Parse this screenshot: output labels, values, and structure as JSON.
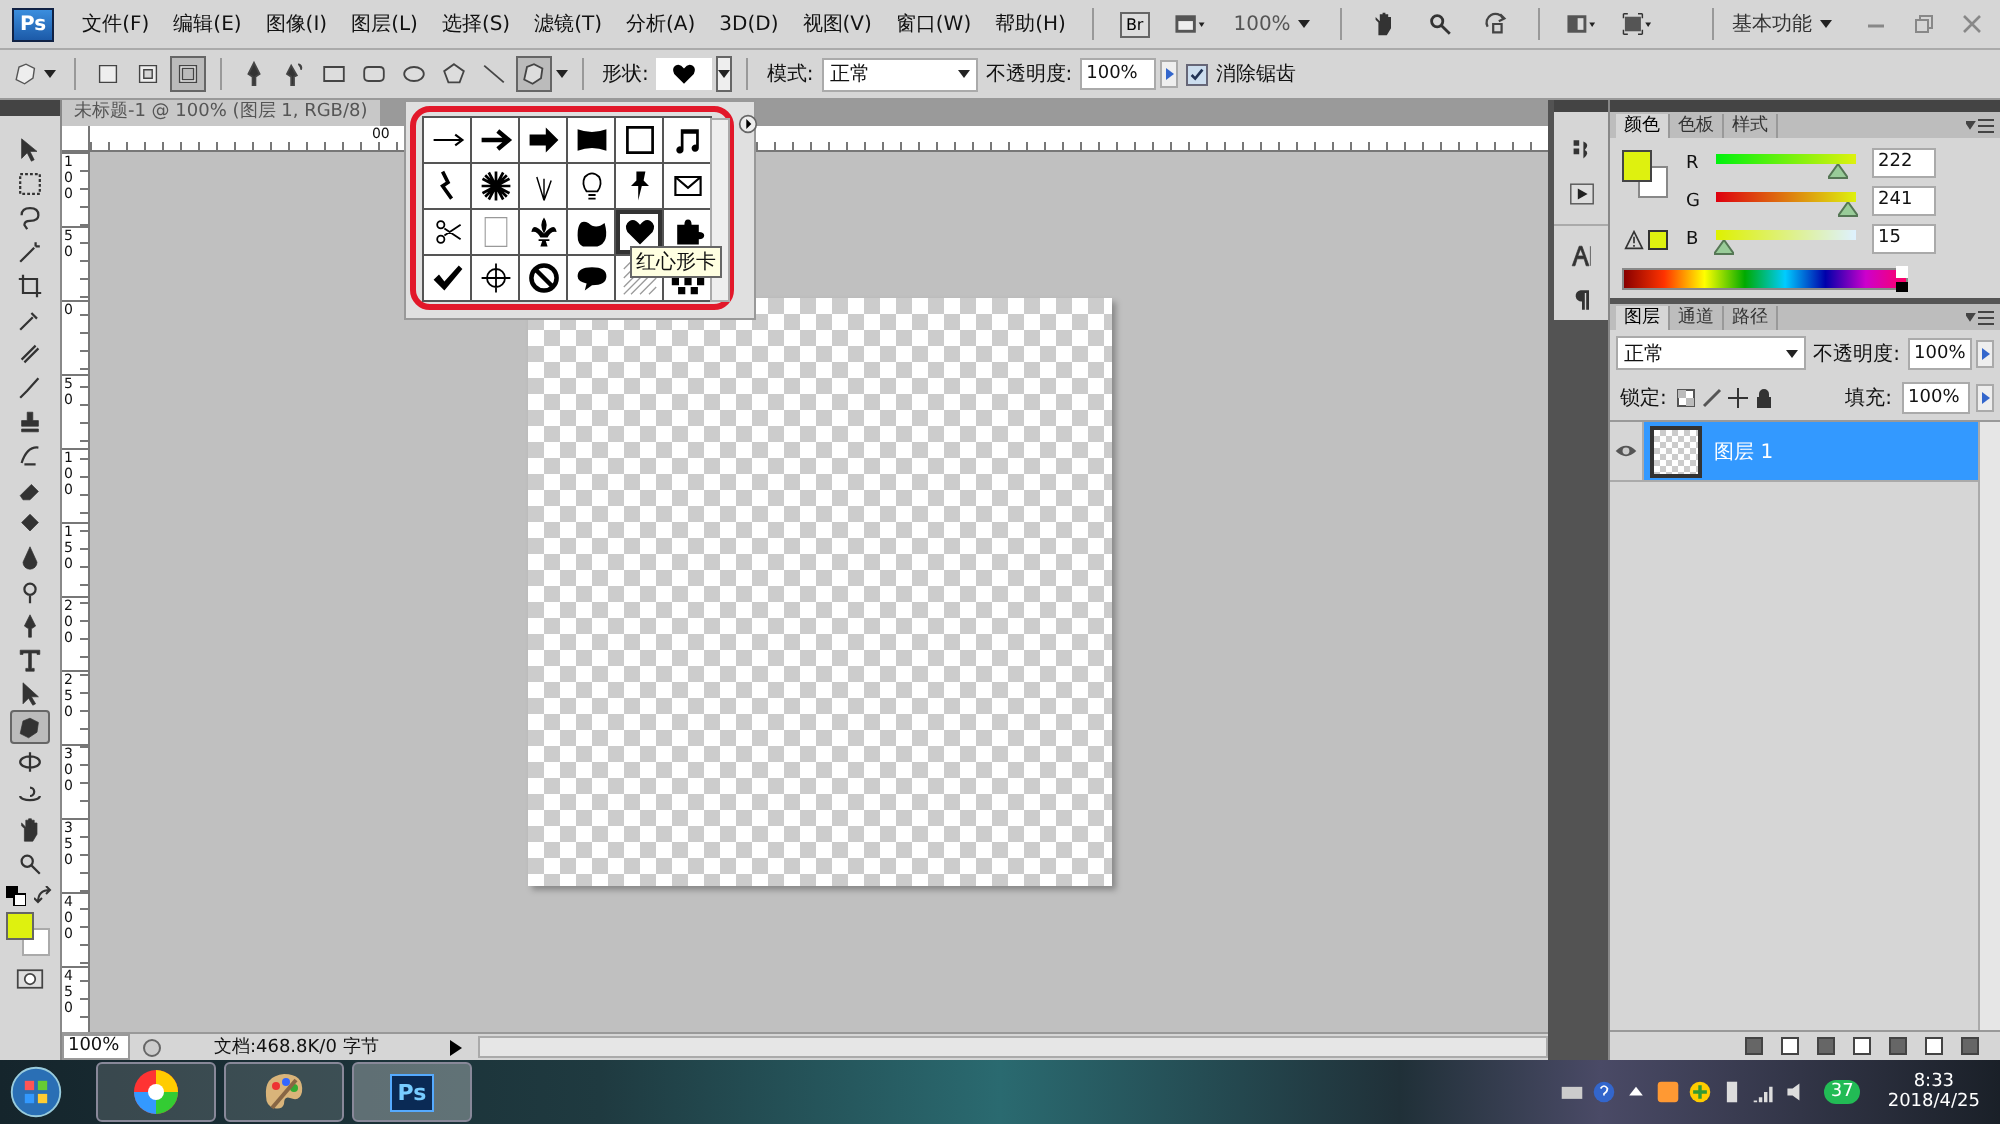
{
  "app_bar": {
    "logo": "Ps",
    "menus": [
      "文件(F)",
      "编辑(E)",
      "图像(I)",
      "图层(L)",
      "选择(S)",
      "滤镜(T)",
      "分析(A)",
      "3D(D)",
      "视图(V)",
      "窗口(W)",
      "帮助(H)"
    ],
    "bridge_button": "Br",
    "zoom": "100%",
    "workspace": "基本功能"
  },
  "options_bar": {
    "path_modes": [
      {
        "kind": "shape-layers",
        "selected": false
      },
      {
        "kind": "paths",
        "selected": false
      },
      {
        "kind": "fill-pixels",
        "selected": true
      }
    ],
    "draw_tools": [
      {
        "kind": "pen",
        "selected": false
      },
      {
        "kind": "freeform-pen",
        "selected": false
      },
      {
        "kind": "rectangle",
        "selected": false
      },
      {
        "kind": "rounded-rectangle",
        "selected": false
      },
      {
        "kind": "ellipse",
        "selected": false
      },
      {
        "kind": "polygon",
        "selected": false
      },
      {
        "kind": "line",
        "selected": false
      },
      {
        "kind": "custom-shape",
        "selected": true
      }
    ],
    "shape_label": "形状:",
    "mode_label": "模式:",
    "mode": "正常",
    "opacity_label": "不透明度:",
    "opacity": "100%",
    "antialias_label": "消除锯齿",
    "antialias": true
  },
  "document": {
    "tab": "未标题-1 @ 100% (图层 1, RGB/8)",
    "top_ruler_labels": [
      "00"
    ],
    "left_ruler_labels": [
      "100",
      "50",
      "0",
      "50",
      "100",
      "150",
      "200",
      "250",
      "300",
      "350",
      "400",
      "450"
    ],
    "zoom": "100%",
    "doc_info": "文档:468.8K/0 字节"
  },
  "toolbox": [
    {
      "kind": "move",
      "selected": false
    },
    {
      "kind": "marquee",
      "selected": false
    },
    {
      "kind": "lasso",
      "selected": false
    },
    {
      "kind": "wand",
      "selected": false
    },
    {
      "kind": "crop",
      "selected": false
    },
    {
      "kind": "eyedropper",
      "selected": false
    },
    {
      "kind": "heal",
      "selected": false
    },
    {
      "kind": "brush",
      "selected": false
    },
    {
      "kind": "stamp",
      "selected": false
    },
    {
      "kind": "history",
      "selected": false
    },
    {
      "kind": "eraser",
      "selected": false
    },
    {
      "kind": "bucket",
      "selected": false
    },
    {
      "kind": "blur",
      "selected": false
    },
    {
      "kind": "dodge",
      "selected": false
    },
    {
      "kind": "pen",
      "selected": false
    },
    {
      "kind": "type",
      "selected": false
    },
    {
      "kind": "path-select",
      "selected": false
    },
    {
      "kind": "shape",
      "selected": true
    },
    {
      "kind": "rotate3d",
      "selected": false
    },
    {
      "kind": "orbit3d",
      "selected": false
    },
    {
      "kind": "hand",
      "selected": false
    },
    {
      "kind": "zoom",
      "selected": false
    }
  ],
  "shape_picker": {
    "shapes": [
      {
        "kind": "arrow-thin",
        "selected": false
      },
      {
        "kind": "arrow",
        "selected": false
      },
      {
        "kind": "arrow-bold",
        "selected": false
      },
      {
        "kind": "banner",
        "selected": false
      },
      {
        "kind": "frame",
        "selected": false
      },
      {
        "kind": "music-note",
        "selected": false
      },
      {
        "kind": "lightning",
        "selected": false
      },
      {
        "kind": "starburst",
        "selected": false
      },
      {
        "kind": "grass",
        "selected": false
      },
      {
        "kind": "lightbulb",
        "selected": false
      },
      {
        "kind": "pushpin",
        "selected": false
      },
      {
        "kind": "envelope",
        "selected": false
      },
      {
        "kind": "scissors",
        "selected": false
      },
      {
        "kind": "blank-frame",
        "selected": false
      },
      {
        "kind": "fleur-de-lis",
        "selected": false
      },
      {
        "kind": "blob",
        "selected": false
      },
      {
        "kind": "heart",
        "selected": true
      },
      {
        "kind": "puzzle",
        "selected": false
      },
      {
        "kind": "checkmark",
        "selected": false
      },
      {
        "kind": "target",
        "selected": false
      },
      {
        "kind": "no-sign",
        "selected": false
      },
      {
        "kind": "speech-bubble",
        "selected": false
      },
      {
        "kind": "hatch",
        "selected": false
      },
      {
        "kind": "dots",
        "selected": false
      }
    ],
    "tooltip": "红心形卡"
  },
  "color_panel": {
    "tabs": [
      {
        "label": "颜色",
        "selected": true
      },
      {
        "label": "色板",
        "selected": false
      },
      {
        "label": "样式",
        "selected": false
      }
    ],
    "channels": [
      {
        "name": "R",
        "value": "222",
        "level": 0.87
      },
      {
        "name": "G",
        "value": "241",
        "level": 0.945
      },
      {
        "name": "B",
        "value": "15",
        "level": 0.06
      }
    ]
  },
  "layers_panel": {
    "tabs": [
      {
        "label": "图层",
        "selected": true
      },
      {
        "label": "通道",
        "selected": false
      },
      {
        "label": "路径",
        "selected": false
      }
    ],
    "blend_mode": "正常",
    "opacity_label": "不透明度:",
    "opacity": "100%",
    "lock_label": "锁定:",
    "fill_label": "填充:",
    "fill": "100%",
    "layers": [
      {
        "name": "图层 1",
        "visible": true,
        "selected": true
      }
    ]
  },
  "taskbar": {
    "ps_label": "Ps",
    "badge": "37",
    "time": "8:33",
    "date": "2018/4/25"
  }
}
